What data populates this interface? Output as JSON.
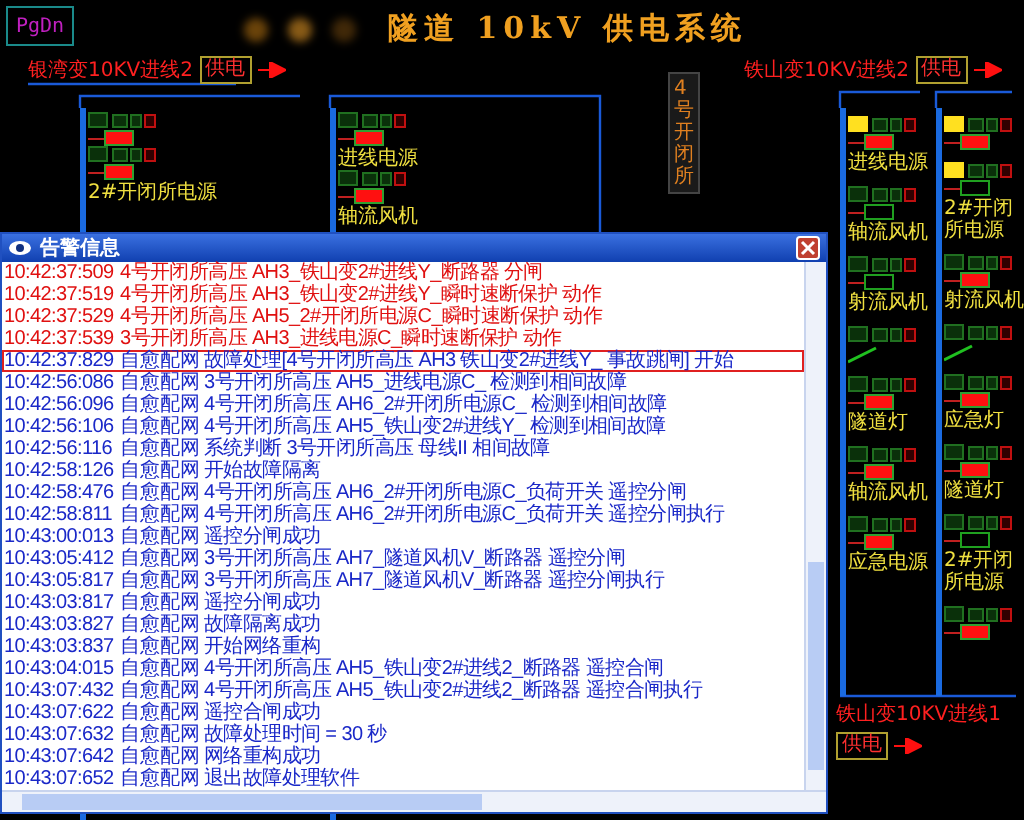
{
  "page_button": "PgDn",
  "title": "隧道 10kV 供电系统",
  "station_label": "4号开闭所",
  "incomers": [
    {
      "label": "银湾变10KV进线2",
      "button": "供电"
    },
    {
      "label": "铁山变10KV进线2",
      "button": "供电"
    },
    {
      "label": "铁山变10KV进线1",
      "button": "供电"
    }
  ],
  "buses": [
    {
      "feeders": [
        {
          "kind": "feeder",
          "alarm": false,
          "closed": true
        },
        {
          "kind": "feeder",
          "label": "2#开闭所电源",
          "alarm": false,
          "closed": true
        }
      ]
    },
    {
      "feeders": [
        {
          "kind": "feeder",
          "label": "进线电源",
          "alarm": false,
          "closed": true
        },
        {
          "kind": "feeder",
          "label": "轴流风机",
          "alarm": false,
          "closed": true
        }
      ]
    },
    {
      "feeders": [
        {
          "kind": "feeder",
          "label": "进线电源",
          "alarm": true,
          "closed": true
        },
        {
          "kind": "feeder",
          "label": "轴流风机",
          "alarm": false,
          "closed": false
        },
        {
          "kind": "feeder",
          "label": "射流风机",
          "alarm": false,
          "closed": false
        },
        {
          "kind": "tie",
          "alarm": false,
          "closed": false
        },
        {
          "kind": "feeder",
          "label": "隧道灯",
          "alarm": false,
          "closed": true
        },
        {
          "kind": "feeder",
          "label": "轴流风机",
          "alarm": false,
          "closed": true
        },
        {
          "kind": "feeder",
          "label": "应急电源",
          "alarm": false,
          "closed": true
        }
      ]
    },
    {
      "feeders": [
        {
          "kind": "feeder",
          "alarm": true,
          "closed": true
        },
        {
          "kind": "feeder",
          "label": "2#开闭所电源",
          "alarm": true,
          "closed": false
        },
        {
          "kind": "feeder",
          "label": "射流风机",
          "alarm": false,
          "closed": true
        },
        {
          "kind": "tie",
          "alarm": false,
          "closed": false
        },
        {
          "kind": "feeder",
          "label": "应急灯",
          "alarm": false,
          "closed": true
        },
        {
          "kind": "feeder",
          "label": "隧道灯",
          "alarm": false,
          "closed": true
        },
        {
          "kind": "feeder",
          "label": "2#开闭所电源",
          "alarm": false,
          "closed": false
        },
        {
          "kind": "feeder",
          "alarm": false,
          "closed": true
        }
      ]
    }
  ],
  "alarm_window": {
    "title": "告警信息",
    "rows": [
      {
        "kind": "alarm",
        "time": "10:42:37:509",
        "text": "4号开闭所高压  AH3_铁山变2#进线Y_断路器  分闸",
        "selected": false
      },
      {
        "kind": "alarm",
        "time": "10:42:37:519",
        "text": "4号开闭所高压  AH3_铁山变2#进线Y_瞬时速断保护  动作",
        "selected": false
      },
      {
        "kind": "alarm",
        "time": "10:42:37:529",
        "text": "4号开闭所高压  AH5_2#开闭所电源C_瞬时速断保护  动作",
        "selected": false
      },
      {
        "kind": "alarm",
        "time": "10:42:37:539",
        "text": "3号开闭所高压  AH3_进线电源C_瞬时速断保护  动作",
        "selected": false
      },
      {
        "kind": "event",
        "time": "10:42:37:829",
        "source": "自愈配网",
        "text": "故障处理[4号开闭所高压 AH3 铁山变2#进线Y_ 事故跳闸] 开始",
        "selected": true
      },
      {
        "kind": "event",
        "time": "10:42:56:086",
        "source": "自愈配网",
        "text": "3号开闭所高压 AH5_进线电源C_ 检测到相间故障",
        "selected": false
      },
      {
        "kind": "event",
        "time": "10:42:56:096",
        "source": "自愈配网",
        "text": "4号开闭所高压 AH6_2#开闭所电源C_ 检测到相间故障",
        "selected": false
      },
      {
        "kind": "event",
        "time": "10:42:56:106",
        "source": "自愈配网",
        "text": "4号开闭所高压 AH5_铁山变2#进线Y_ 检测到相间故障",
        "selected": false
      },
      {
        "kind": "event",
        "time": "10:42:56:116",
        "source": "自愈配网",
        "text": "系统判断 3号开闭所高压 母线II 相间故障",
        "selected": false
      },
      {
        "kind": "event",
        "time": "10:42:58:126",
        "source": "自愈配网",
        "text": "开始故障隔离",
        "selected": false
      },
      {
        "kind": "event",
        "time": "10:42:58:476",
        "source": "自愈配网",
        "text": "4号开闭所高压 AH6_2#开闭所电源C_负荷开关  遥控分闸",
        "selected": false
      },
      {
        "kind": "event",
        "time": "10:42:58:811",
        "source": "自愈配网",
        "text": "4号开闭所高压 AH6_2#开闭所电源C_负荷开关  遥控分闸执行",
        "selected": false
      },
      {
        "kind": "event",
        "time": "10:43:00:013",
        "source": "自愈配网",
        "text": "遥控分闸成功",
        "selected": false
      },
      {
        "kind": "event",
        "time": "10:43:05:412",
        "source": "自愈配网",
        "text": "3号开闭所高压 AH7_隧道风机V_断路器  遥控分闸",
        "selected": false
      },
      {
        "kind": "event",
        "time": "10:43:05:817",
        "source": "自愈配网",
        "text": "3号开闭所高压 AH7_隧道风机V_断路器  遥控分闸执行",
        "selected": false
      },
      {
        "kind": "event",
        "time": "10:43:03:817",
        "source": "自愈配网",
        "text": "遥控分闸成功",
        "selected": false
      },
      {
        "kind": "event",
        "time": "10:43:03:827",
        "source": "自愈配网",
        "text": "故障隔离成功",
        "selected": false
      },
      {
        "kind": "event",
        "time": "10:43:03:837",
        "source": "自愈配网",
        "text": "开始网络重构",
        "selected": false
      },
      {
        "kind": "event",
        "time": "10:43:04:015",
        "source": "自愈配网",
        "text": "4号开闭所高压 AH5_铁山变2#进线2_断路器  遥控合闸",
        "selected": false
      },
      {
        "kind": "event",
        "time": "10:43:07:432",
        "source": "自愈配网",
        "text": "4号开闭所高压 AH5_铁山变2#进线2_断路器  遥控合闸执行",
        "selected": false
      },
      {
        "kind": "event",
        "time": "10:43:07:622",
        "source": "自愈配网",
        "text": "遥控合闸成功",
        "selected": false
      },
      {
        "kind": "event",
        "time": "10:43:07:632",
        "source": "自愈配网",
        "text": "故障处理时间 = 30 秒",
        "selected": false
      },
      {
        "kind": "event",
        "time": "10:43:07:642",
        "source": "自愈配网",
        "text": "网络重构成功",
        "selected": false
      },
      {
        "kind": "event",
        "time": "10:43:07:652",
        "source": "自愈配网",
        "text": "退出故障处理软件",
        "selected": false
      }
    ]
  }
}
